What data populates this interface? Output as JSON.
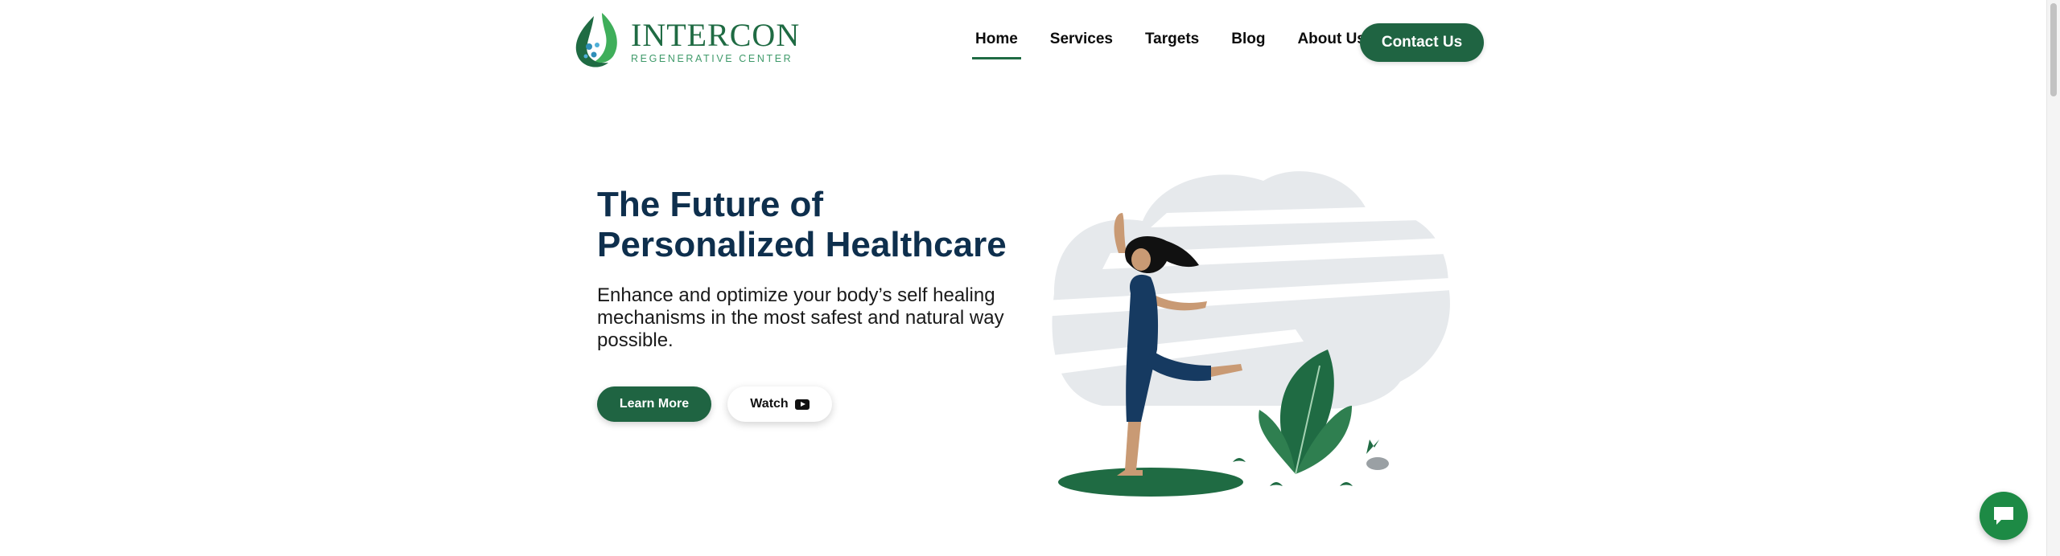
{
  "brand": {
    "name": "INTERCON",
    "tagline": "REGENERATIVE CENTER",
    "icon": "leaf-drop-logo",
    "primary_color": "#1f6442",
    "accent_color": "#3fae5a",
    "title_color": "#0e2f4d"
  },
  "nav": {
    "items": [
      {
        "label": "Home",
        "active": true
      },
      {
        "label": "Services",
        "active": false
      },
      {
        "label": "Targets",
        "active": false
      },
      {
        "label": "Blog",
        "active": false
      },
      {
        "label": "About Us",
        "active": false
      }
    ],
    "contact_label": "Contact Us"
  },
  "hero": {
    "title": "The Future of Personalized Healthcare",
    "subtitle": "Enhance and optimize your body’s self healing mechanisms in the most safest and natural way possible.",
    "learn_more_label": "Learn More",
    "watch_label": "Watch",
    "watch_icon": "youtube-play-icon",
    "illustration": "dancing-woman-with-plant"
  },
  "chat": {
    "icon": "chat-bubble-icon"
  }
}
